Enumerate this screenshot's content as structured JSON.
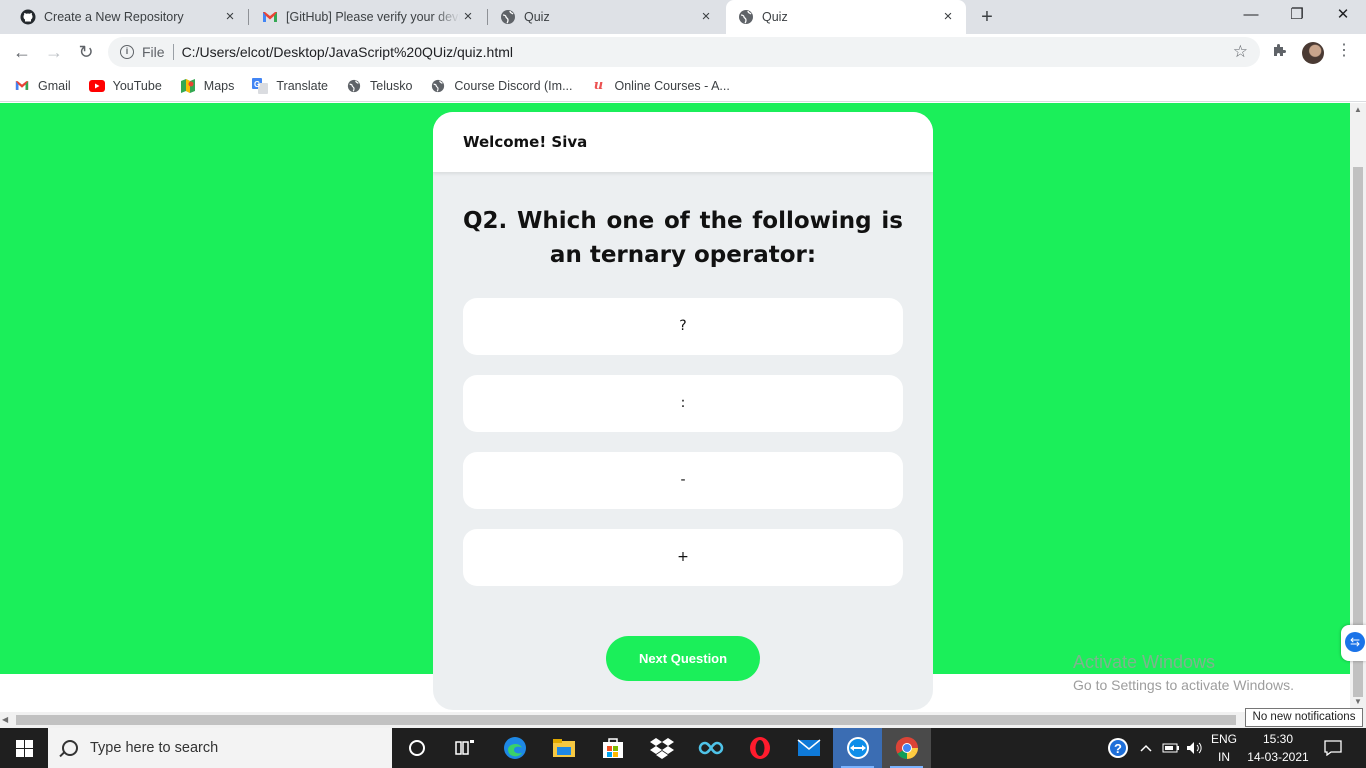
{
  "browser": {
    "tabs": [
      {
        "title": "Create a New Repository",
        "icon": "github-icon",
        "active": false
      },
      {
        "title": "[GitHub] Please verify your device",
        "icon": "gmail-icon",
        "active": false
      },
      {
        "title": "Quiz",
        "icon": "globe-icon",
        "active": false
      },
      {
        "title": "Quiz",
        "icon": "globe-icon",
        "active": true
      }
    ],
    "new_tab_symbol": "+",
    "controls": {
      "minimize": "—",
      "restore": "❐",
      "close": "✕"
    },
    "omnibox": {
      "scheme_label": "File",
      "url": "C:/Users/elcot/Desktop/JavaScript%20QUiz/quiz.html"
    },
    "bookmarks": [
      {
        "label": "Gmail",
        "icon": "gmail-icon"
      },
      {
        "label": "YouTube",
        "icon": "youtube-icon"
      },
      {
        "label": "Maps",
        "icon": "maps-icon"
      },
      {
        "label": "Translate",
        "icon": "translate-icon"
      },
      {
        "label": "Telusko",
        "icon": "globe-icon"
      },
      {
        "label": "Course Discord (Im...",
        "icon": "globe-icon"
      },
      {
        "label": "Online Courses - A...",
        "icon": "udemy-icon"
      }
    ]
  },
  "quiz": {
    "welcome": "Welcome! Siva",
    "question": "Q2. Which one of the following is an ternary operator:",
    "options": [
      "?",
      ":",
      "-",
      "+"
    ],
    "next_label": "Next Question",
    "accent_color": "#1bef5a"
  },
  "watermark": {
    "title": "Activate Windows",
    "subtitle": "Go to Settings to activate Windows."
  },
  "notification_toast": "No new notifications",
  "taskbar": {
    "search_placeholder": "Type here to search",
    "language": {
      "line1": "ENG",
      "line2": "IN"
    },
    "time": "15:30",
    "date": "14-03-2021"
  }
}
